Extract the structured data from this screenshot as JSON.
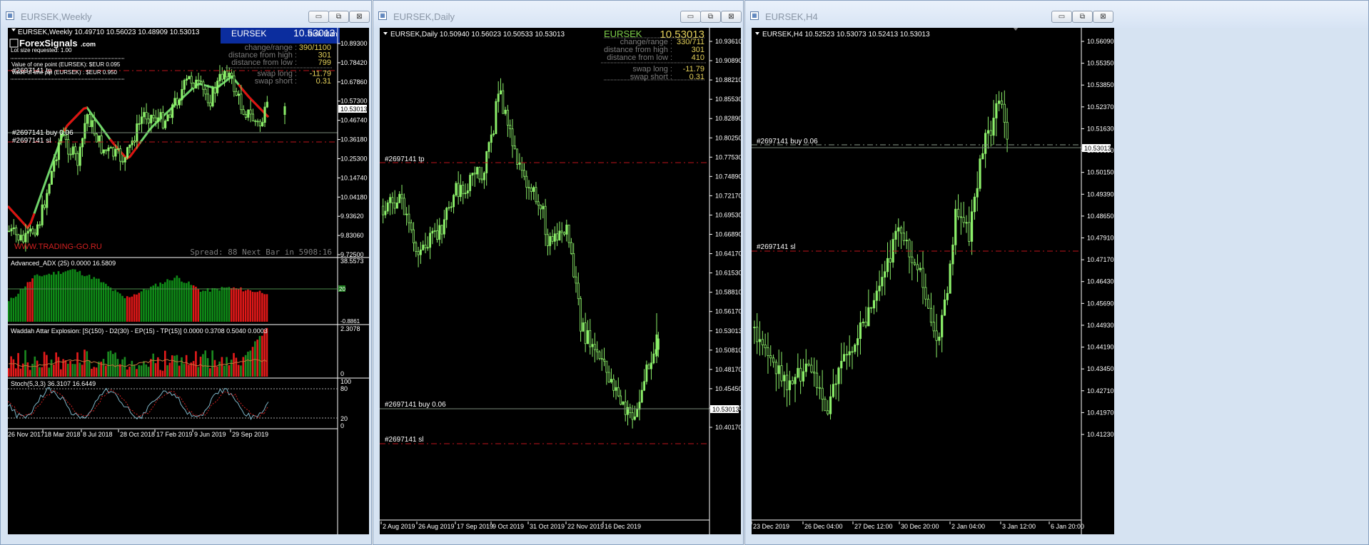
{
  "windows": [
    {
      "title": "EURSEK,Weekly",
      "header": "EURSEK,Weekly  10.49710 10.56023 10.48909 10.53013",
      "price_labels": [
        "10.89300",
        "10.78420",
        "10.67860",
        "10.57300",
        "10.46740",
        "10.36180",
        "10.25300",
        "10.14740",
        "10.04180",
        "9.93620",
        "9.83060",
        "9.72500"
      ],
      "current_price": "10.53013",
      "date_labels": [
        "26 Nov 2017",
        "18 Mar 2018",
        "8 Jul 2018",
        "28 Oct 2018",
        "17 Feb 2019",
        "9 Jun 2019",
        "29 Sep 2019"
      ],
      "order_labels": [
        "#2697141 tp",
        "#2697141 buy 0.06",
        "#2697141 sl"
      ],
      "logo": "ForexSignals",
      "logo_suffix": ".com",
      "info_lines": [
        "Lot size requested: 1.00",
        "Value of one point (EURSEK):  $EUR 0.095",
        "Value of one pip    (EURSEK) : $EUR 0.950"
      ],
      "watermark": "WWW.TRADING-GO.RU",
      "spread": "Spread: 88  Next Bar in 5908:16",
      "info_box": {
        "symbol": "EURSEK",
        "price": "10.53013",
        "suffix": "Risk Man",
        "rows": [
          {
            "label": "change/range :",
            "value": "390/1100"
          },
          {
            "label": "distance from high :",
            "value": "301"
          },
          {
            "label": "distance from low :",
            "value": "799"
          },
          {
            "label": "swap long :",
            "value": "-11.79"
          },
          {
            "label": "swap short :",
            "value": "0.31"
          }
        ]
      },
      "indicators": [
        {
          "name": "Advanced_ADX (25) 0.0000 16.5809",
          "scale_top": "38.5573",
          "scale_bottom": "0.00",
          "scale_alt": "-0.8861",
          "level": "20"
        },
        {
          "name": "Waddah Attar Explosion: [S(150) - D2(30) - EP(15) - TP(15)] 0.0000 0.3708 0.5040 0.0003",
          "scale_top": "2.3078",
          "scale_bottom": "0"
        },
        {
          "name": "Stoch(5,3,3) 36.3107 16.6449",
          "scale_top": "100",
          "scale_80": "80",
          "scale_20": "20",
          "scale_bottom": "0"
        }
      ]
    },
    {
      "title": "EURSEK,Daily",
      "header": "EURSEK,Daily  10.50940 10.56023 10.50533 10.53013",
      "price_labels": [
        "10.93610",
        "10.90890",
        "10.88210",
        "10.85530",
        "10.82890",
        "10.80250",
        "10.77530",
        "10.74890",
        "10.72170",
        "10.69530",
        "10.66890",
        "10.64170",
        "10.61530",
        "10.58810",
        "10.56170",
        "10.53013",
        "10.50810",
        "10.48170",
        "10.45450",
        "10.42810",
        "10.40170"
      ],
      "current_price": "10.53013",
      "date_labels": [
        "2 Aug 2019",
        "26 Aug 2019",
        "17 Sep 2019",
        "9 Oct 2019",
        "31 Oct 2019",
        "22 Nov 2019",
        "16 Dec 2019"
      ],
      "order_labels": [
        "#2697141 tp",
        "#2697141 buy 0.06",
        "#2697141 sl"
      ],
      "info_box": {
        "symbol": "EURSEK",
        "price": "10.53013",
        "rows": [
          {
            "label": "change/range :",
            "value": "330/711"
          },
          {
            "label": "distance from high :",
            "value": "301"
          },
          {
            "label": "distance from low :",
            "value": "410"
          },
          {
            "label": "swap long :",
            "value": "-11.79"
          },
          {
            "label": "swap short :",
            "value": "0.31"
          }
        ]
      }
    },
    {
      "title": "EURSEK,H4",
      "header": "EURSEK,H4  10.52523 10.53073 10.52413 10.53013",
      "price_labels": [
        "10.56090",
        "10.55350",
        "10.53850",
        "10.52370",
        "10.51630",
        "10.50890",
        "10.50150",
        "10.49390",
        "10.48650",
        "10.47910",
        "10.47170",
        "10.46430",
        "10.45690",
        "10.44930",
        "10.44190",
        "10.43450",
        "10.42710",
        "10.41970",
        "10.41230"
      ],
      "current_price": "10.53013",
      "date_labels": [
        "23 Dec 2019",
        "26 Dec 04:00",
        "27 Dec 12:00",
        "30 Dec 20:00",
        "2 Jan 04:00",
        "3 Jan 12:00",
        "6 Jan 20:00"
      ],
      "order_labels": [
        "#2697141 buy 0.06",
        "#2697141 sl"
      ]
    }
  ],
  "controls": {
    "minimize": "▭",
    "restore": "⧉",
    "close": "⊠"
  },
  "colors": {
    "bull": "#8cf06a",
    "bear": "#000000",
    "tp_sl": "#c0141b",
    "buy": "#8a9a8a",
    "ma_green": "#6fd36a",
    "ma_red": "#e01010",
    "adx_green": "#0f8a17",
    "adx_red": "#e01818",
    "wae_green": "#1b8a20",
    "wae_red": "#e51b1b",
    "stoch_main": "#7fb7c9",
    "stoch_signal": "#d02020",
    "info_yellow": "#e6d25a",
    "info_gray": "#7b7b7b"
  }
}
